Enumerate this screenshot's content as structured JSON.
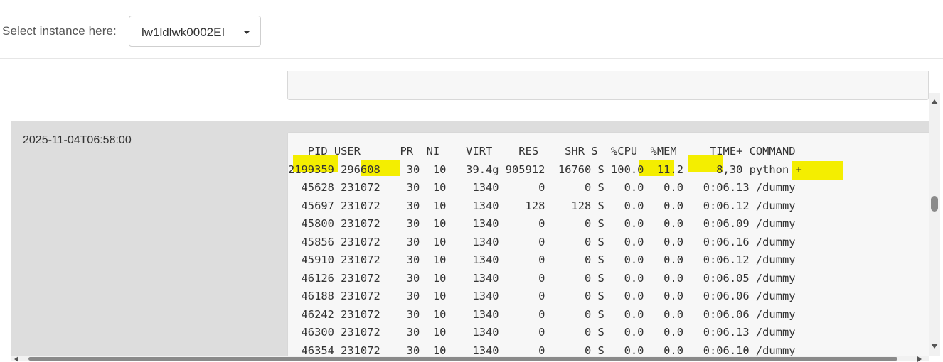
{
  "selector": {
    "label": "Select instance here:",
    "value": "lw1ldlwk0002EI"
  },
  "entry": {
    "timestamp": "2025-11-04T06:58:00"
  },
  "top_output": {
    "header": "   PID USER      PR  NI    VIRT    RES    SHR S  %CPU  %MEM     TIME+ COMMAND",
    "rows": [
      "2199359 296608    30  10   39.4g 905912  16760 S 100.0  11.2     8,30 python +",
      "  45628 231072    30  10    1340      0      0 S   0.0   0.0   0:06.13 /dummy",
      "  45697 231072    30  10    1340    128    128 S   0.0   0.0   0:06.12 /dummy",
      "  45800 231072    30  10    1340      0      0 S   0.0   0.0   0:06.09 /dummy",
      "  45856 231072    30  10    1340      0      0 S   0.0   0.0   0:06.16 /dummy",
      "  45910 231072    30  10    1340      0      0 S   0.0   0.0   0:06.12 /dummy",
      "  46126 231072    30  10    1340      0      0 S   0.0   0.0   0:06.05 /dummy",
      "  46188 231072    30  10    1340      0      0 S   0.0   0.0   0:06.06 /dummy",
      "  46242 231072    30  10    1340      0      0 S   0.0   0.0   0:06.06 /dummy",
      "  46300 231072    30  10    1340      0      0 S   0.0   0.0   0:06.13 /dummy",
      "  46354 231072    30  10    1340      0      0 S   0.0   0.0   0:06.10 /dummy"
    ]
  },
  "colors": {
    "highlight": "#f4ee00",
    "row_band": "#dddddd",
    "output_bg": "#f7f7f7"
  },
  "icons": {
    "dropdown": "caret-down-icon",
    "scroll_up": "arrow-up-icon",
    "scroll_down": "arrow-down-icon"
  }
}
